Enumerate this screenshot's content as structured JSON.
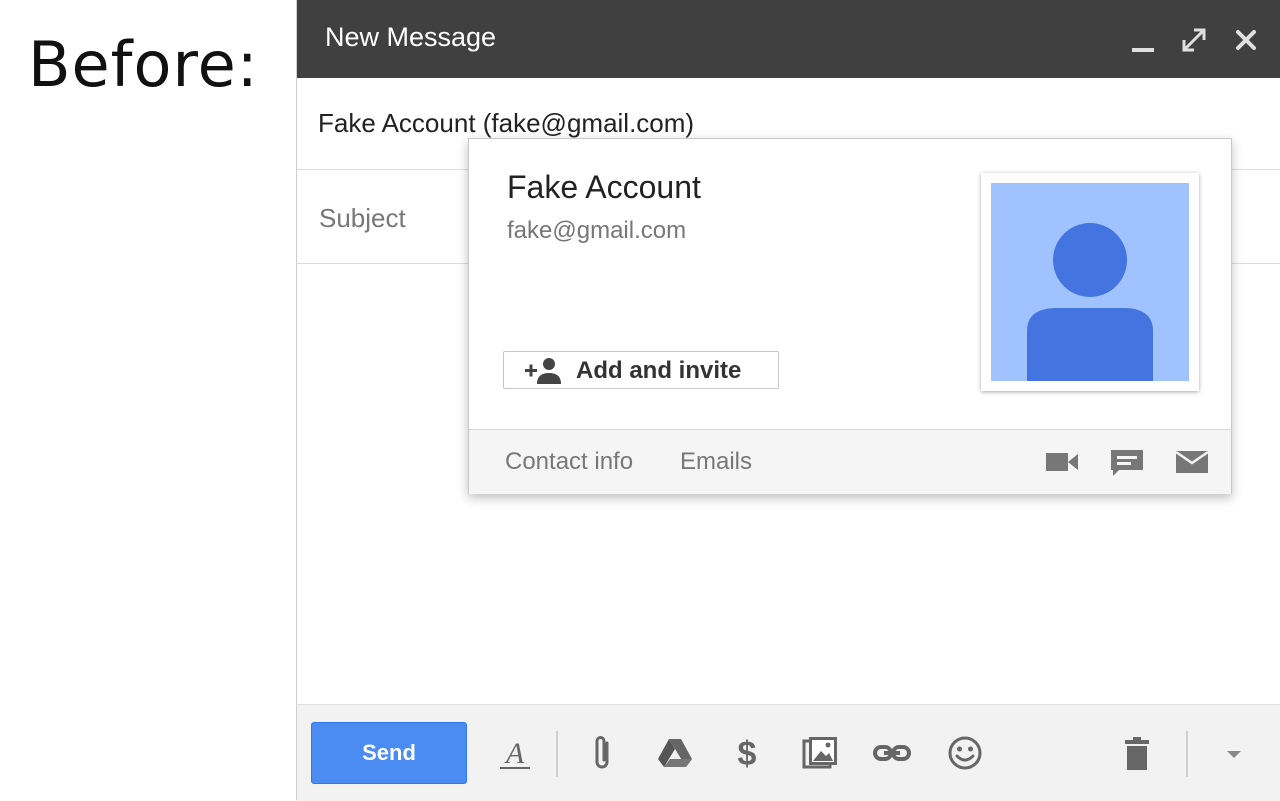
{
  "caption": "Before:",
  "compose": {
    "title": "New Message",
    "recipient": "Fake Account (fake@gmail.com)",
    "subject_placeholder": "Subject",
    "send_label": "Send"
  },
  "contact_card": {
    "name": "Fake Account",
    "email": "fake@gmail.com",
    "add_invite_label": "Add and invite",
    "links": [
      "Contact info",
      "Emails"
    ]
  },
  "colors": {
    "titlebar": "#404040",
    "send_button": "#4a8cf1",
    "avatar_bg": "#a0c3ff",
    "avatar_fg": "#4374e0"
  },
  "icons": {
    "titlebar": [
      "minimize-icon",
      "fullscreen-icon",
      "close-icon"
    ],
    "toolbar": [
      "formatting-icon",
      "attach-icon",
      "drive-icon",
      "money-icon",
      "photo-icon",
      "link-icon",
      "emoji-icon",
      "trash-icon",
      "more-options-icon"
    ],
    "card": [
      "add-contact-icon",
      "video-call-icon",
      "chat-icon",
      "email-icon"
    ]
  }
}
